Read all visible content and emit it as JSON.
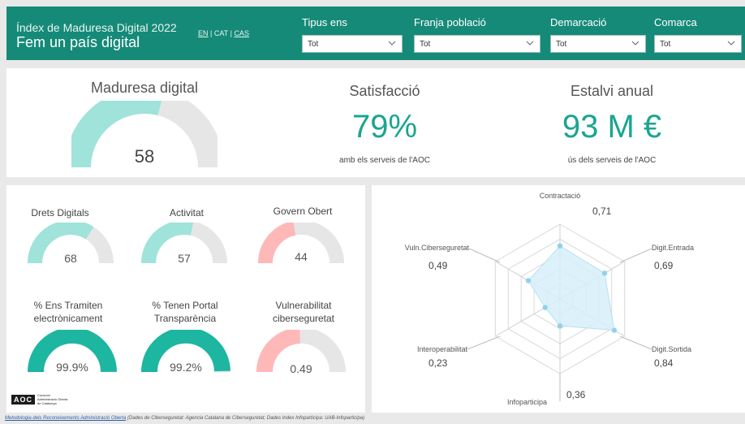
{
  "header": {
    "title": "Índex de Maduresa Digital 2022",
    "subtitle": "Fem un país digital",
    "lang_en": "EN",
    "lang_cat": "CAT",
    "lang_cas": "CAS",
    "sep": "|"
  },
  "filters": [
    {
      "label": "Tipus ens",
      "value": "Tot"
    },
    {
      "label": "Franja població",
      "value": "Tot"
    },
    {
      "label": "Demarcació",
      "value": "Tot"
    },
    {
      "label": "Comarca",
      "value": "Tot"
    }
  ],
  "kpis": {
    "maturity": {
      "title": "Maduresa digital",
      "value": "58",
      "level": 58
    },
    "satisfaction": {
      "title": "Satisfacció",
      "value": "79%",
      "note": "amb els serveis de l'AOC"
    },
    "savings": {
      "title": "Estalvi anual",
      "value": "93 M €",
      "note": "ús dels serveis de l'AOC"
    }
  },
  "gauges": [
    {
      "title": "Drets Digitals",
      "value": "68",
      "level": 68,
      "color": "#9fe3da"
    },
    {
      "title": "Activitat",
      "value": "57",
      "level": 57,
      "color": "#9fe3da"
    },
    {
      "title": "Govern Obert",
      "value": "44",
      "level": 44,
      "color": "#ffb8b8"
    },
    {
      "title": "% Ens Tramiten electrònicament",
      "line1": "% Ens Tramiten",
      "line2": "electrònicament",
      "value": "99.9%",
      "level": 99.9,
      "color": "#1db6a1"
    },
    {
      "title": "% Tenen Portal Transparència",
      "line1": "% Tenen Portal",
      "line2": "Transparència",
      "value": "99.2%",
      "level": 99.2,
      "color": "#1db6a1"
    },
    {
      "title": "Vulnerabilitat ciberseguretat",
      "line1": "Vulnerabilitat",
      "line2": "ciberseguretat",
      "value": "0.49",
      "level": 49,
      "color": "#ffb8b8"
    }
  ],
  "chart_data": {
    "type": "radar",
    "categories": [
      "Contractació",
      "Digit.Entrada",
      "Digit.Sortida",
      "Infoparticipa",
      "Interoperabilitat",
      "Vuln.Ciberseguretat"
    ],
    "values": [
      0.71,
      0.69,
      0.84,
      0.36,
      0.23,
      0.49
    ],
    "value_labels": [
      "0,71",
      "0,69",
      "0,84",
      "0,36",
      "0,23",
      "0,49"
    ],
    "range": [
      0,
      1
    ],
    "fill_color": "#d6eef8",
    "point_color": "#8ed3ee"
  },
  "footer": {
    "link": "Metodologia dels Reconeixements Administració Oberta",
    "note": "(Dades de Ciberseguretat: Agencia Catalana de Ciberseguretat; Dades Index Infoparticipa: UAB-Infoparticipa)"
  },
  "logo": {
    "mark": "AOC",
    "text": "Consorci Administració Oberta de Catalunya"
  },
  "colors": {
    "brand": "#168a78",
    "accent": "#1aa591"
  }
}
